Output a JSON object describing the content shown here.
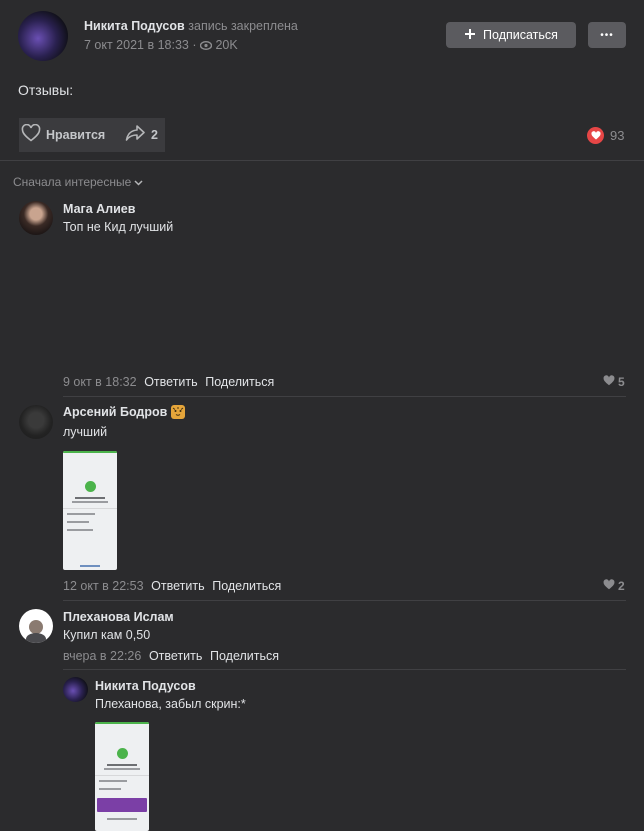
{
  "post": {
    "author": "Никита Подусов",
    "pinned_note": "запись закреплена",
    "date": "7 окт 2021 в 18:33 ·",
    "views": "20K",
    "subscribe_label": "Подписаться",
    "more_label": "•••",
    "text": "Отзывы:",
    "like_label": "Нравится",
    "share_count": "2",
    "likes_total": "93"
  },
  "sort": {
    "label": "Сначала интересные"
  },
  "comments": [
    {
      "name": "Мага Алиев",
      "text": "Топ не Кид лучший",
      "date": "9 окт в 18:32",
      "reply": "Ответить",
      "share": "Поделиться",
      "likes": "5"
    },
    {
      "name": "Арсений Бодров",
      "text": "лучший",
      "date": "12 окт в 22:53",
      "reply": "Ответить",
      "share": "Поделиться",
      "likes": "2"
    },
    {
      "name": "Плеханова Ислам",
      "text": "Купил кам 0,50",
      "date": "вчера в 22:26",
      "reply": "Ответить",
      "share": "Поделиться"
    },
    {
      "name": "Никита Подусов",
      "text": "Плеханова, забыл скрин:*"
    }
  ],
  "colors": {
    "background": "#2b2b2d",
    "accent_green": "#4bb34b",
    "like_red": "#e64646",
    "button": "#5b5b5f"
  }
}
